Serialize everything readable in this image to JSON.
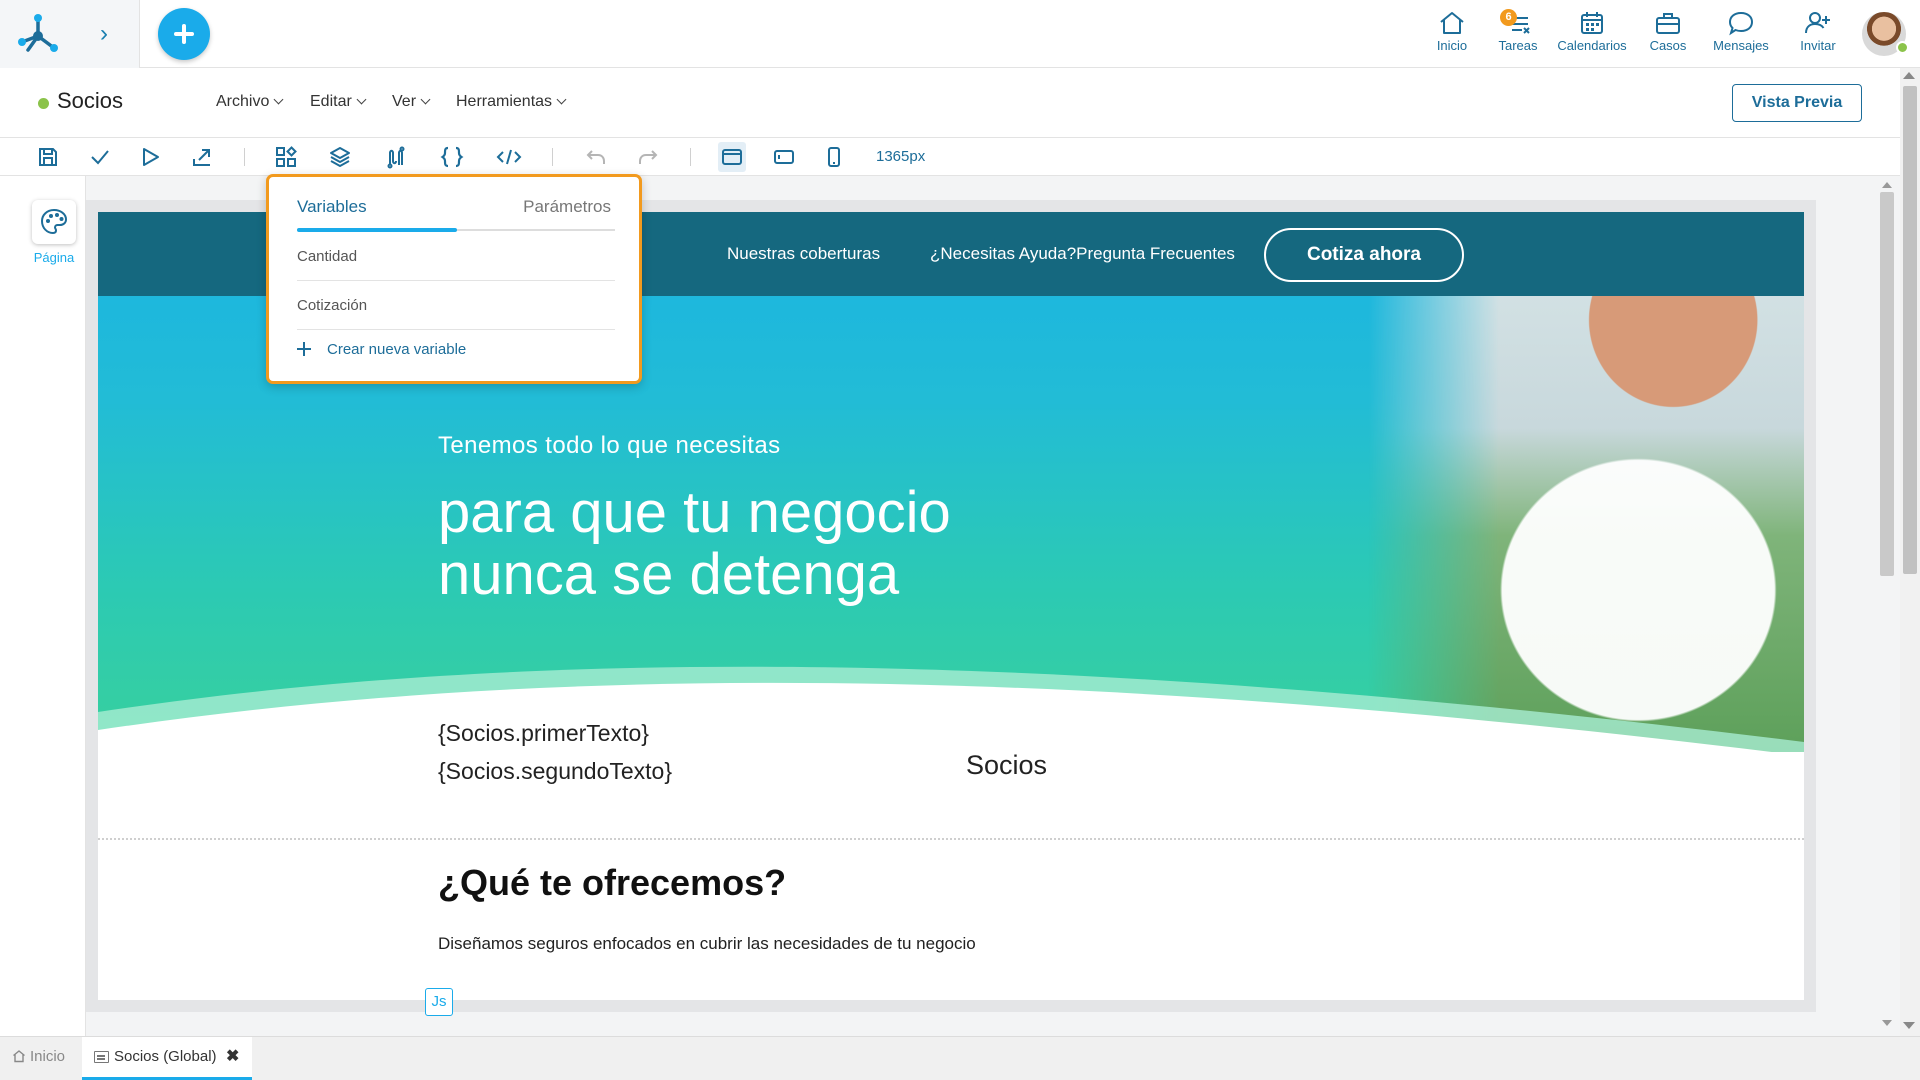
{
  "topnav": {
    "items": [
      {
        "label": "Inicio",
        "icon": "home-icon"
      },
      {
        "label": "Tareas",
        "icon": "tasks-icon",
        "badge": "6"
      },
      {
        "label": "Calendarios",
        "icon": "calendar-icon"
      },
      {
        "label": "Casos",
        "icon": "briefcase-icon"
      },
      {
        "label": "Mensajes",
        "icon": "message-icon"
      },
      {
        "label": "Invitar",
        "icon": "invite-user-icon"
      }
    ]
  },
  "menubar": {
    "title": "Socios",
    "menus": [
      "Archivo",
      "Editar",
      "Ver",
      "Herramientas"
    ],
    "preview_label": "Vista Previa"
  },
  "toolbar": {
    "viewport_size": "1365px"
  },
  "leftpanel": {
    "page_label": "Página"
  },
  "dropdown": {
    "tabs": [
      "Variables",
      "Parámetros"
    ],
    "items": [
      "Cantidad",
      "Cotización"
    ],
    "create_label": "Crear nueva variable"
  },
  "page": {
    "nav_links": [
      "Nuestras coberturas",
      "¿Necesitas Ayuda?Pregunta Frecuentes"
    ],
    "cta_label": "Cotiza ahora",
    "hero_subtitle": "Tenemos todo lo que necesitas",
    "hero_title_line1": "para que tu negocio",
    "hero_title_line2": "nunca se detenga",
    "var_line1": "{Socios.primerTexto}",
    "var_line2": "{Socios.segundoTexto}",
    "socios_label": "Socios",
    "section_title": "¿Qué te ofrecemos?",
    "section_text": "Diseñamos seguros enfocados en cubrir las necesidades de tu negocio",
    "js_badge": "Js"
  },
  "tabs": {
    "home_label": "Inicio",
    "active_label": "Socios (Global)",
    "close_glyph": "✖"
  },
  "colors": {
    "primary": "#1aabea",
    "dark_blue": "#1d6d99",
    "accent_orange": "#f29a1e",
    "status_green": "#8bc34a",
    "hero_nav": "#15687f"
  }
}
